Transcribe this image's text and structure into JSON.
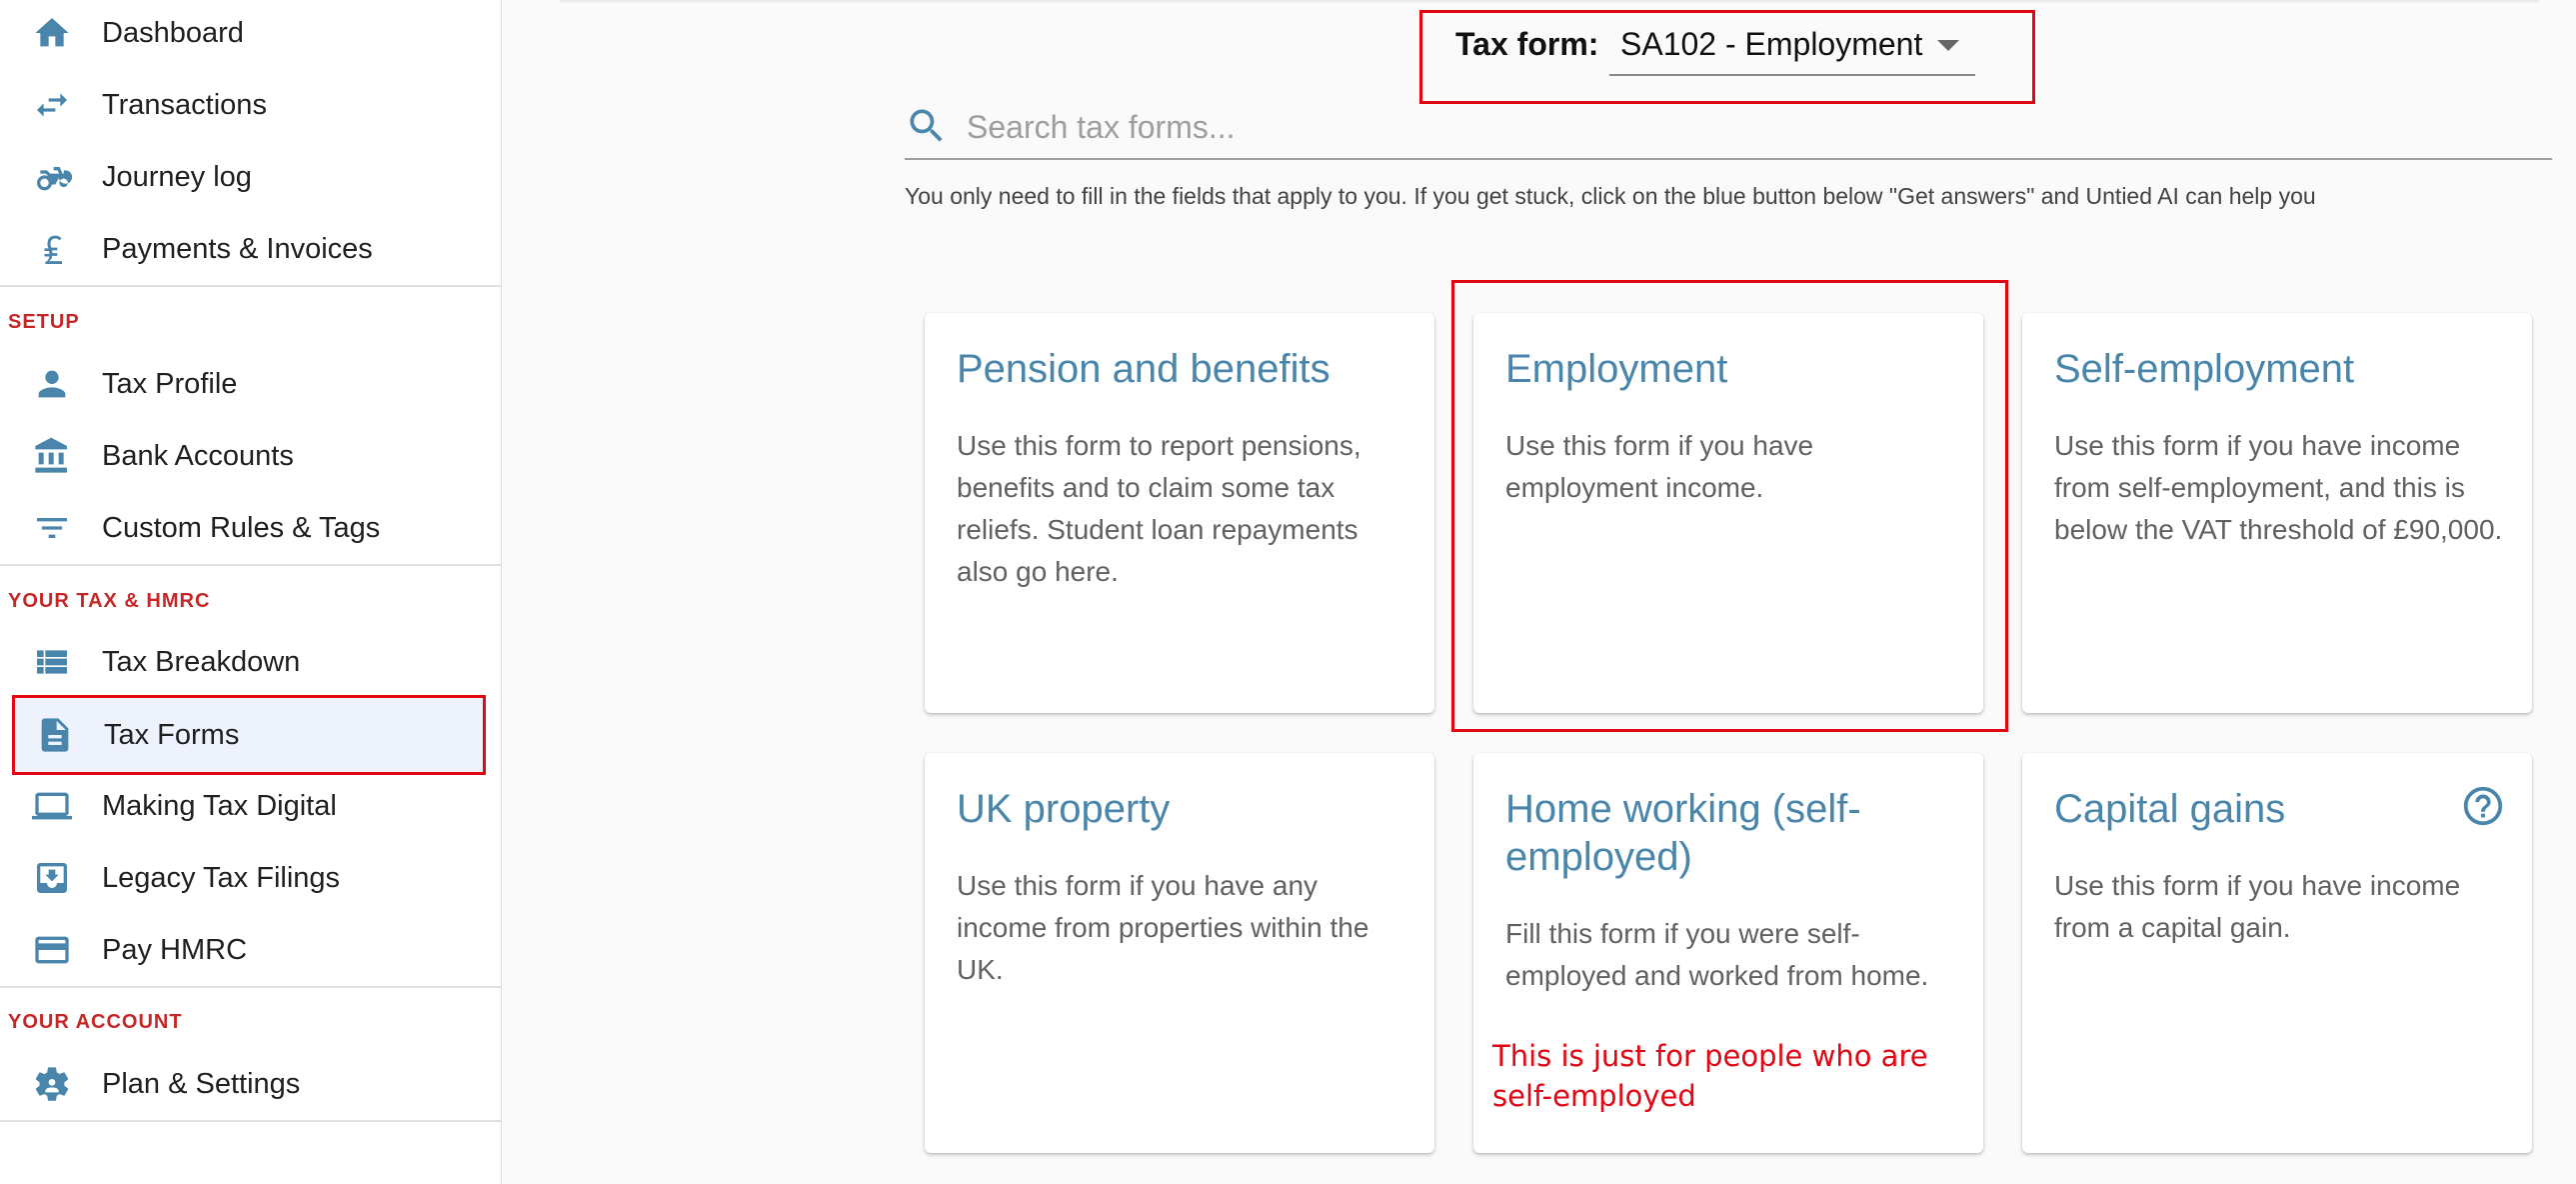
{
  "sidebar": {
    "items": [
      {
        "label": "Dashboard",
        "icon": "home-icon"
      },
      {
        "label": "Transactions",
        "icon": "swap-arrows-icon"
      },
      {
        "label": "Journey log",
        "icon": "motorbike-icon"
      },
      {
        "label": "Payments & Invoices",
        "icon": "pound-icon"
      }
    ],
    "setup_title": "SETUP",
    "setup_items": [
      {
        "label": "Tax Profile",
        "icon": "person-icon"
      },
      {
        "label": "Bank Accounts",
        "icon": "bank-icon"
      },
      {
        "label": "Custom Rules & Tags",
        "icon": "filter-icon"
      }
    ],
    "tax_title": "YOUR TAX & HMRC",
    "tax_items": [
      {
        "label": "Tax Breakdown",
        "icon": "list-icon"
      },
      {
        "label": "Tax Forms",
        "icon": "document-icon",
        "active": true
      },
      {
        "label": "Making Tax Digital",
        "icon": "laptop-icon"
      },
      {
        "label": "Legacy Tax Filings",
        "icon": "archive-icon"
      },
      {
        "label": "Pay HMRC",
        "icon": "credit-card-icon"
      }
    ],
    "account_title": "YOUR ACCOUNT",
    "account_items": [
      {
        "label": "Plan & Settings",
        "icon": "gear-person-icon"
      }
    ]
  },
  "tax_form": {
    "label": "Tax form:",
    "selected": "SA102 - Employment"
  },
  "search": {
    "placeholder": "Search tax forms..."
  },
  "helper_text": "You only need to fill in the fields that apply to you. If you get stuck, click on the blue button below \"Get answers\" and Untied AI can help you",
  "cards": [
    {
      "title": "Pension and benefits",
      "description": "Use this form to report pensions, benefits and to claim some tax reliefs. Student loan repayments also go here."
    },
    {
      "title": "Employment",
      "description": "Use this form if you have employment income."
    },
    {
      "title": "Self-employment",
      "description": "Use this form if you have income from self-employment, and this is below the VAT threshold of £90,000."
    },
    {
      "title": "UK property",
      "description": "Use this form if you have any income from properties within the UK."
    },
    {
      "title": "Home working (self-employed)",
      "description": "Fill this form if you were self-employed and worked from home."
    },
    {
      "title": "Capital gains",
      "description": "Use this form if you have income from a capital gain.",
      "help_icon": "help-circle-icon"
    }
  ],
  "annotation": "This is just for people who are self-employed",
  "colors": {
    "accent": "#4a86ac",
    "section_title": "#c62828",
    "highlight": "#e30613",
    "active_bg": "#eef2fc"
  }
}
